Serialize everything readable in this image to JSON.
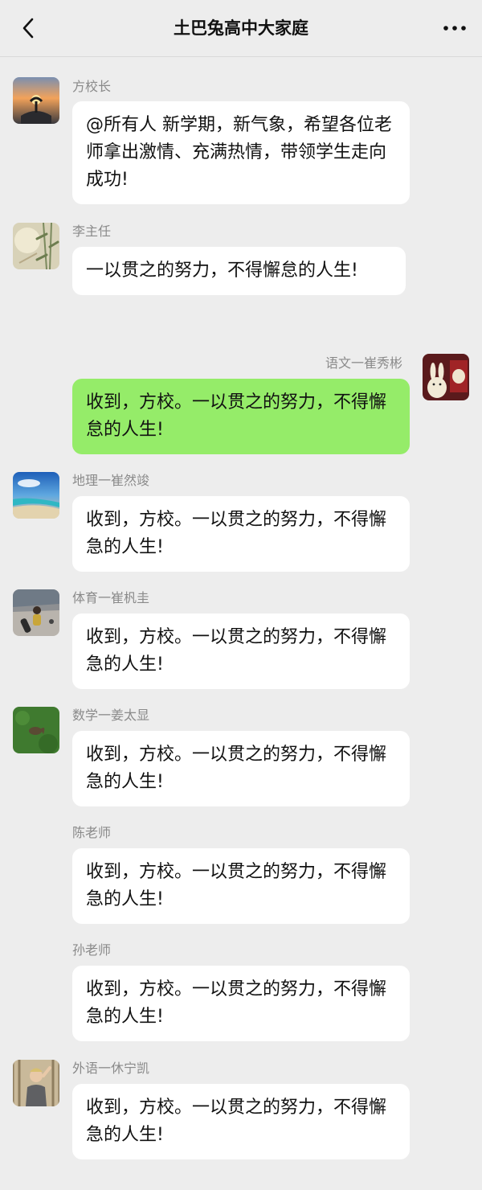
{
  "header": {
    "title": "土巴兔高中大家庭",
    "back_icon": "chevron-left-icon",
    "more_icon": "more-horizontal-icon"
  },
  "messages": [
    {
      "sender": "方校长",
      "text": "@所有人 新学期，新气象，希望各位老师拿出激情、充满热情，带领学生走向成功!",
      "mine": false,
      "avatar": "sunset-tree-avatar"
    },
    {
      "sender": "李主任",
      "text": "一以贯之的努力，不得懈怠的人生!",
      "mine": false,
      "avatar": "bamboo-avatar"
    },
    {
      "sender": "语文一崔秀彬",
      "text": "收到，方校。一以贯之的努力，不得懈怠的人生!",
      "mine": true,
      "avatar": "rabbit-figure-avatar"
    },
    {
      "sender": "地理一崔然竣",
      "text": "收到，方校。一以贯之的努力，不得懈急的人生!",
      "mine": false,
      "avatar": "beach-avatar"
    },
    {
      "sender": "体育一崔杋圭",
      "text": "收到，方校。一以贯之的努力，不得懈急的人生!",
      "mine": false,
      "avatar": "skateboarder-avatar"
    },
    {
      "sender": "数学一姜太显",
      "text": "收到，方校。一以贯之的努力，不得懈急的人生!",
      "mine": false,
      "avatar": "squirrel-grass-avatar"
    },
    {
      "sender": "陈老师",
      "text": "收到，方校。一以贯之的努力，不得懈急的人生!",
      "mine": false,
      "avatar": "blank-avatar"
    },
    {
      "sender": "孙老师",
      "text": "收到，方校。一以贯之的努力，不得懈急的人生!",
      "mine": false,
      "avatar": "blank-avatar"
    },
    {
      "sender": "外语一休宁凯",
      "text": "收到，方校。一以贯之的努力，不得懈急的人生!",
      "mine": false,
      "avatar": "person-photo-avatar"
    }
  ]
}
